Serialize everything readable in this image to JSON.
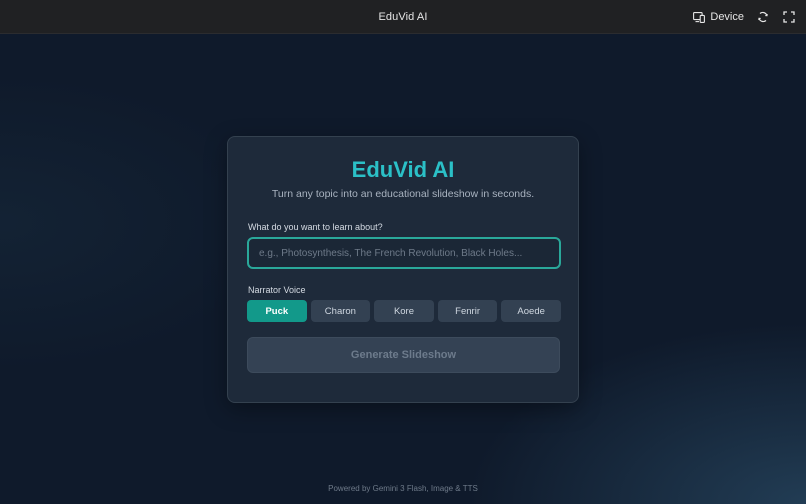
{
  "topbar": {
    "title": "EduVid AI",
    "device_label": "Device",
    "icons": [
      "device-icon",
      "rotate-icon",
      "fullscreen-icon"
    ]
  },
  "card": {
    "title": "EduVid AI",
    "subtitle": "Turn any topic into an educational slideshow in seconds.",
    "topic_label": "What do you want to learn about?",
    "topic_placeholder": "e.g., Photosynthesis, The French Revolution, Black Holes...",
    "topic_value": "",
    "voice_label": "Narrator Voice",
    "voices": [
      "Puck",
      "Charon",
      "Kore",
      "Fenrir",
      "Aoede"
    ],
    "selected_voice": "Puck",
    "generate_label": "Generate Slideshow"
  },
  "footer": {
    "text": "Powered by Gemini 3 Flash, Image & TTS"
  },
  "colors": {
    "accent": "#2bc0c7",
    "active_voice": "#12998a",
    "input_border": "#2aa89a"
  }
}
